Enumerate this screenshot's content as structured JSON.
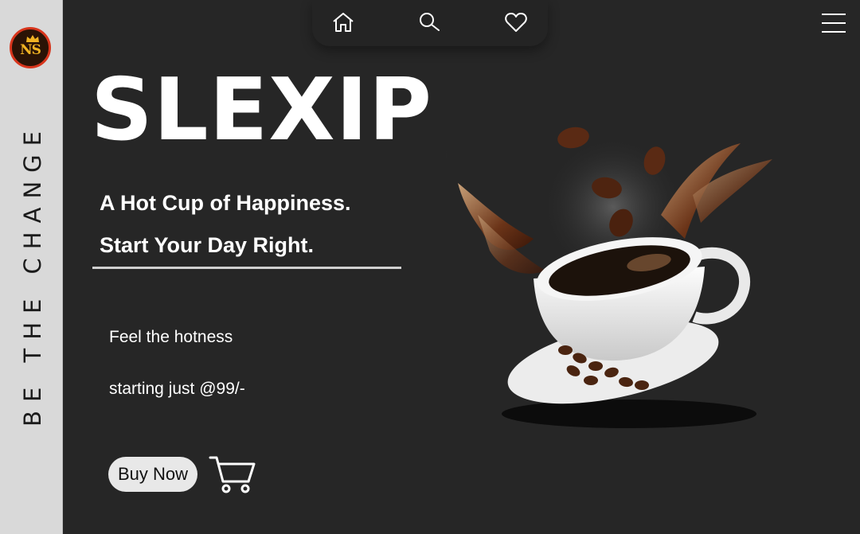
{
  "sidebar": {
    "logo": {
      "letters": "NS"
    },
    "tagline": "BE THE CHANGE"
  },
  "nav": {
    "icons": [
      "home-icon",
      "search-icon",
      "heart-icon"
    ],
    "menu_icon": "hamburger-menu-icon"
  },
  "hero": {
    "brand": "SLEXIP",
    "headline_1": "A Hot Cup of Happiness.",
    "headline_2": "Start Your Day Right.",
    "body_1": "Feel the hotness",
    "body_2": "starting just @99/-",
    "cta_label": "Buy Now",
    "cart_icon": "cart-icon",
    "image": "coffee-cup-with-splash-and-beans"
  },
  "colors": {
    "background": "#262626",
    "sidebar": "#d9d9d9",
    "text": "#ffffff",
    "logo_accent": "#f0b323",
    "logo_ring": "#d8351c"
  }
}
